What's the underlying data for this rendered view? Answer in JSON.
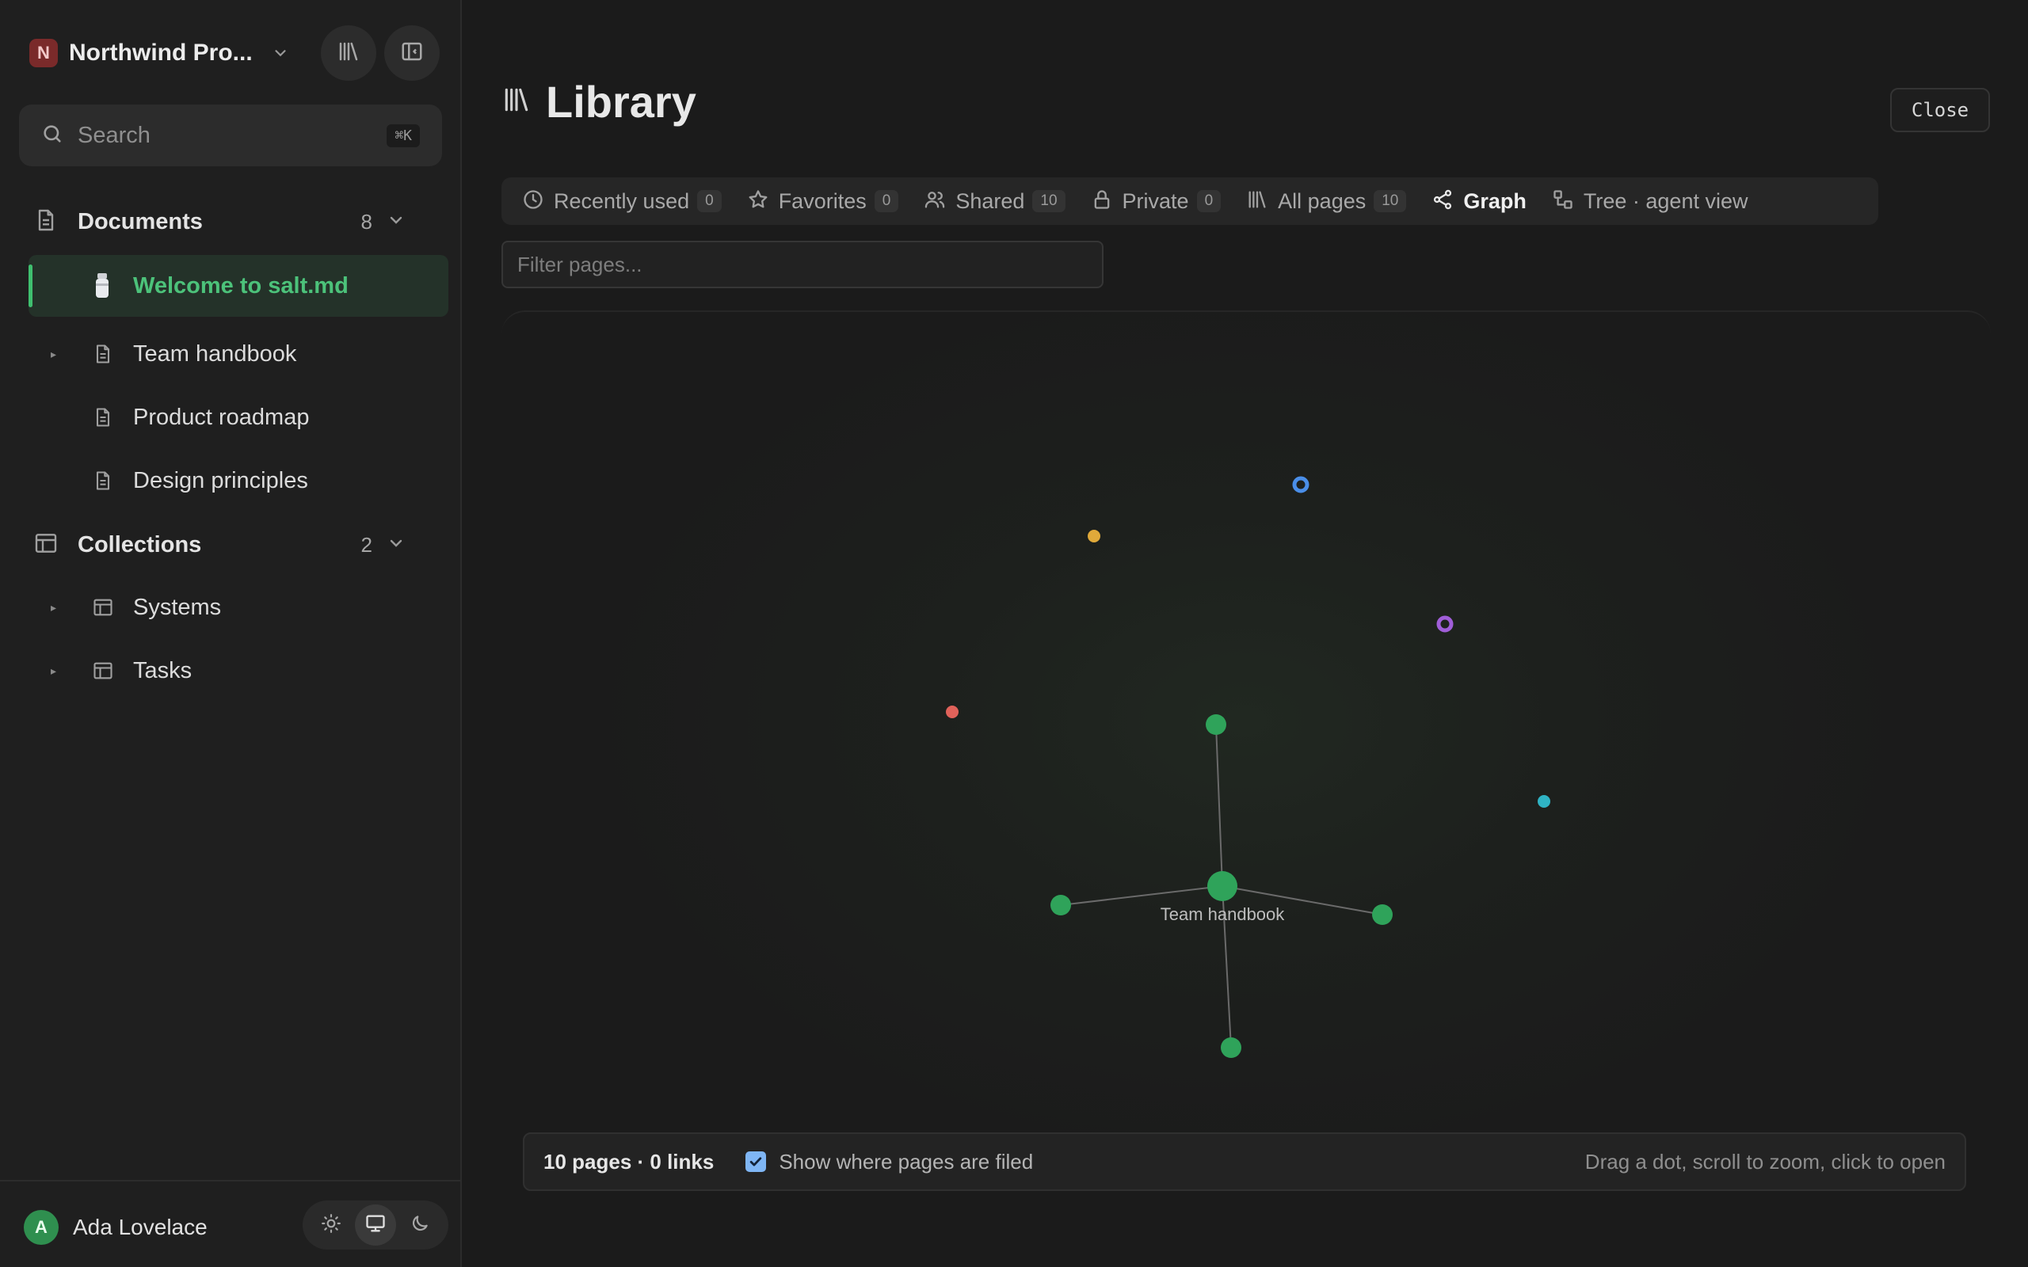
{
  "workspace": {
    "initial": "N",
    "name": "Northwind Pro..."
  },
  "search": {
    "placeholder": "Search",
    "shortcut": "⌘K"
  },
  "sidebar": {
    "documents": {
      "label": "Documents",
      "count": "8",
      "items": [
        {
          "label": "Welcome to salt.md",
          "icon": "salt-shaker-icon",
          "active": true
        },
        {
          "label": "Team handbook",
          "icon": "document-icon"
        },
        {
          "label": "Product roadmap",
          "icon": "document-icon"
        },
        {
          "label": "Design principles",
          "icon": "document-icon"
        }
      ]
    },
    "collections": {
      "label": "Collections",
      "count": "2",
      "items": [
        {
          "label": "Systems",
          "icon": "table-icon"
        },
        {
          "label": "Tasks",
          "icon": "table-icon"
        }
      ]
    }
  },
  "user": {
    "initial": "A",
    "name": "Ada Lovelace"
  },
  "theme": {
    "selected": "system"
  },
  "page": {
    "title": "Library",
    "close_label": "Close"
  },
  "tabs": [
    {
      "label": "Recently used",
      "count": "0",
      "icon": "clock-icon"
    },
    {
      "label": "Favorites",
      "count": "0",
      "icon": "star-icon"
    },
    {
      "label": "Shared",
      "count": "10",
      "icon": "users-icon"
    },
    {
      "label": "Private",
      "count": "0",
      "icon": "lock-icon"
    },
    {
      "label": "All pages",
      "count": "10",
      "icon": "library-icon"
    },
    {
      "label": "Graph",
      "icon": "graph-icon",
      "active": true
    },
    {
      "label": "Tree · agent view",
      "icon": "tree-icon"
    }
  ],
  "filter": {
    "placeholder": "Filter pages..."
  },
  "graph": {
    "center_label": "Team handbook",
    "colors": {
      "green": "#2fa35a",
      "blue": "#4a8ee8",
      "yellow": "#e0a93a",
      "purple": "#a05ed8",
      "red": "#e0625a",
      "cyan": "#2fb3c4",
      "edge": "#6a6a6a"
    },
    "stats": "10 pages · 0 links",
    "show_filed_label": "Show where pages are filed",
    "show_filed_checked": true,
    "hint": "Drag a dot, scroll to zoom, click to open"
  }
}
